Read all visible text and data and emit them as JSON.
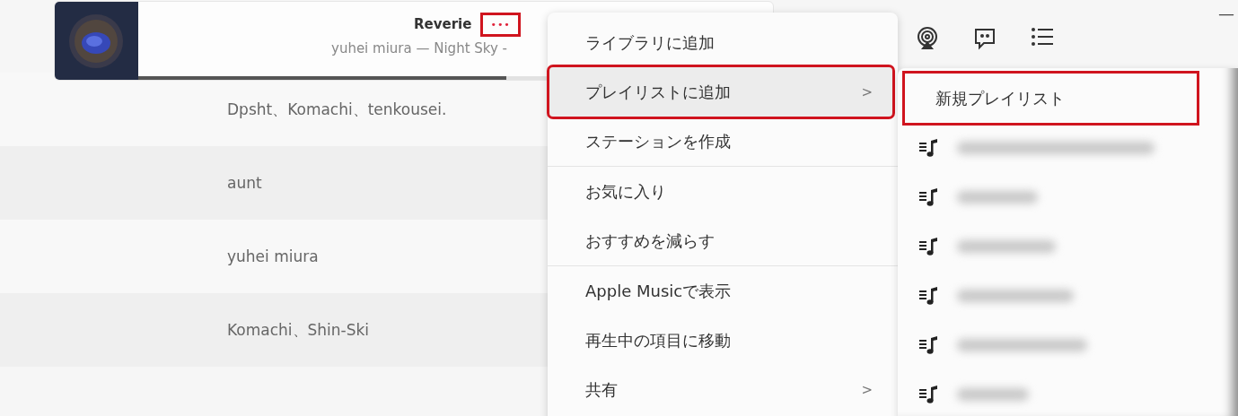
{
  "now_playing": {
    "title": "Reverie",
    "subtitle": "yuhei miura — Night Sky -",
    "more_button": {
      "label": "•••",
      "highlighted": true
    },
    "progress": {
      "level": 0.58
    }
  },
  "toolbar": [
    {
      "kind": "airplay"
    },
    {
      "kind": "lyrics"
    },
    {
      "kind": "queue"
    }
  ],
  "window_controls": {
    "minimize": "—"
  },
  "rows": [
    {
      "artist": "Dpsht、Komachi、tenkousei."
    },
    {
      "artist": "aunt"
    },
    {
      "artist": "yuhei miura"
    },
    {
      "artist": "Komachi、Shin-Ski"
    }
  ],
  "context_menu": {
    "items": [
      {
        "label": "ライブラリに追加",
        "submenu": false,
        "selected": false,
        "highlighted": false,
        "divider_after": false
      },
      {
        "label": "プレイリストに追加",
        "submenu": true,
        "selected": true,
        "highlighted": true,
        "divider_after": false
      },
      {
        "label": "ステーションを作成",
        "submenu": false,
        "selected": false,
        "highlighted": false,
        "divider_after": true
      },
      {
        "label": "お気に入り",
        "submenu": false,
        "selected": false,
        "highlighted": false,
        "divider_after": false
      },
      {
        "label": "おすすめを減らす",
        "submenu": false,
        "selected": false,
        "highlighted": false,
        "divider_after": true
      },
      {
        "label": "Apple Musicで表示",
        "submenu": false,
        "selected": false,
        "highlighted": false,
        "divider_after": false
      },
      {
        "label": "再生中の項目に移動",
        "submenu": false,
        "selected": false,
        "highlighted": false,
        "divider_after": false
      },
      {
        "label": "共有",
        "submenu": true,
        "selected": false,
        "highlighted": false,
        "divider_after": false
      }
    ],
    "chevron": ">"
  },
  "submenu": {
    "items": [
      {
        "kind": "action",
        "label": "新規プレイリスト",
        "highlighted": true
      },
      {
        "kind": "playlist"
      },
      {
        "kind": "playlist"
      },
      {
        "kind": "playlist"
      },
      {
        "kind": "playlist"
      },
      {
        "kind": "playlist"
      },
      {
        "kind": "playlist"
      }
    ]
  }
}
